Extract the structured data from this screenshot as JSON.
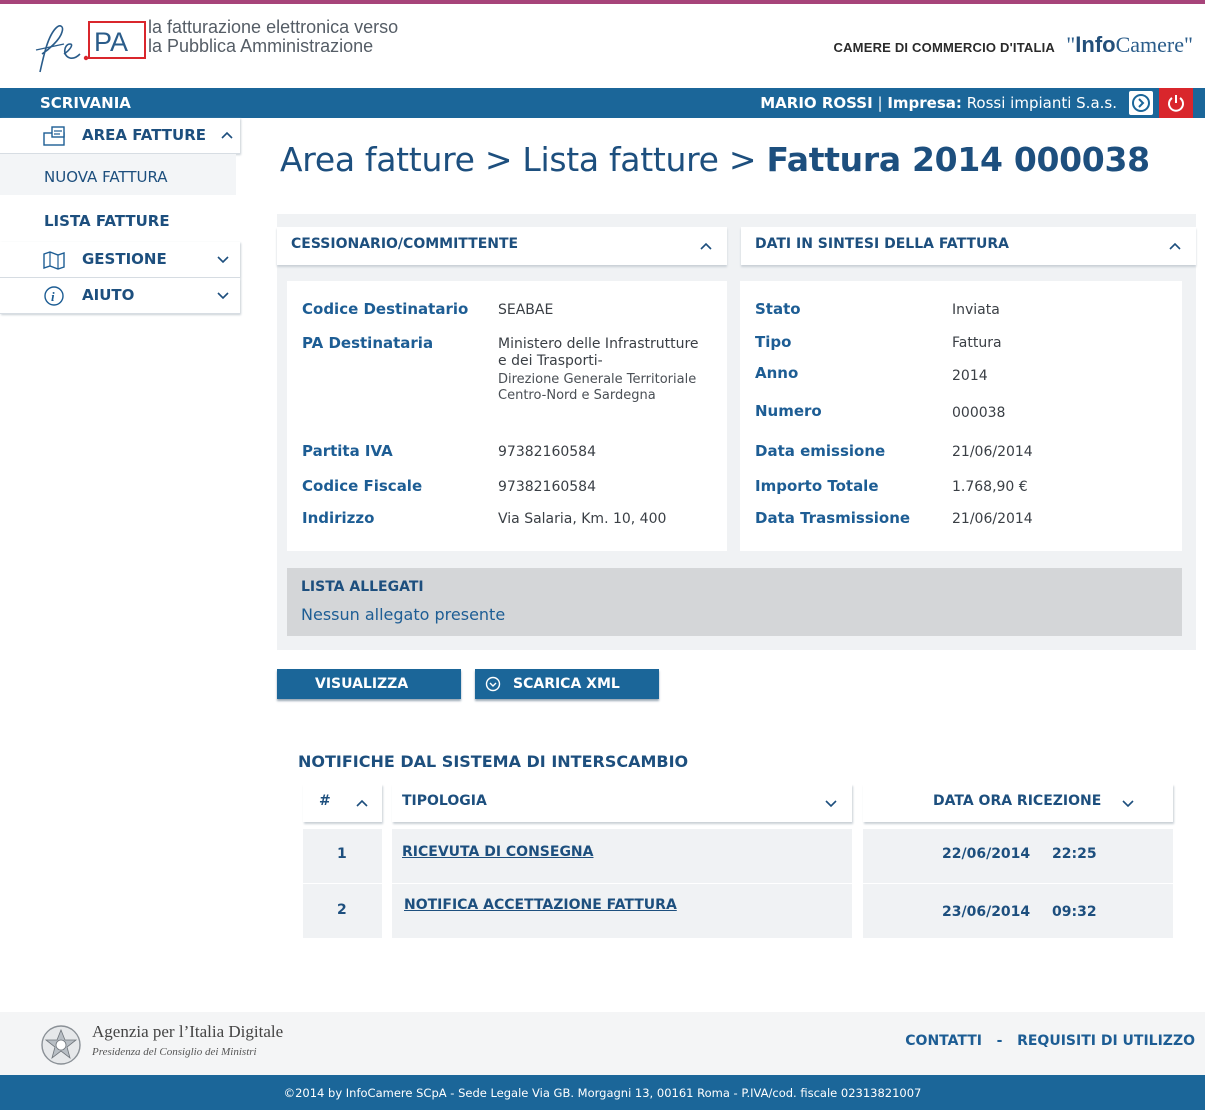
{
  "header": {
    "logo_text": "PA",
    "logo_subtitle_line1": "la fatturazione elettronica verso",
    "logo_subtitle_line2": "la Pubblica Amministrazione",
    "camere_label": "CAMERE DI COMMERCIO D'ITALIA",
    "infocamere_bold": "Info",
    "infocamere_rest": "Camere",
    "infocamere_quote_open": "\"",
    "infocamere_quote_close": "\""
  },
  "topbar": {
    "scrivania": "SCRIVANIA",
    "user_name": "MARIO ROSSI",
    "separator": "|",
    "impresa_label": "Impresa:",
    "impresa_value": "Rossi impianti S.a.s."
  },
  "sidebar": {
    "area_fatture": "AREA FATTURE",
    "nuova_fattura": "NUOVA FATTURA",
    "lista_fatture": "LISTA FATTURE",
    "gestione": "GESTIONE",
    "aiuto": "AIUTO"
  },
  "breadcrumb": {
    "part1": "Area fatture",
    "sep": ">",
    "part2": "Lista fatture",
    "current": "Fattura 2014 000038"
  },
  "cessionario": {
    "title": "CESSIONARIO/COMMITTENTE",
    "codice_destinatario_label": "Codice Destinatario",
    "codice_destinatario_value": "SEABAE",
    "pa_destinataria_label": "PA Destinataria",
    "pa_line1": "Ministero delle Infrastrutture",
    "pa_line2": "e dei Trasporti-",
    "pa_line3": "Direzione Generale Territoriale",
    "pa_line4": "Centro-Nord e Sardegna",
    "partita_iva_label": "Partita IVA",
    "partita_iva_value": "97382160584",
    "codice_fiscale_label": "Codice Fiscale",
    "codice_fiscale_value": "97382160584",
    "indirizzo_label": "Indirizzo",
    "indirizzo_value": "Via Salaria, Km. 10, 400"
  },
  "sintesi": {
    "title": "DATI IN SINTESI DELLA FATTURA",
    "stato_label": "Stato",
    "stato_value": "Inviata",
    "tipo_label": "Tipo",
    "tipo_value": "Fattura",
    "anno_label": "Anno",
    "anno_value": "2014",
    "numero_label": "Numero",
    "numero_value": "000038",
    "data_emissione_label": "Data emissione",
    "data_emissione_value": "21/06/2014",
    "importo_label": "Importo Totale",
    "importo_value": "1.768,90 €",
    "data_trasmissione_label": "Data Trasmissione",
    "data_trasmissione_value": "21/06/2014"
  },
  "allegati": {
    "title": "LISTA ALLEGATI",
    "empty": "Nessun allegato presente"
  },
  "actions": {
    "visualizza": "VISUALIZZA",
    "scarica_xml": "SCARICA XML"
  },
  "notifiche": {
    "title": "NOTIFICHE DAL SISTEMA DI INTERSCAMBIO",
    "col_num": "#",
    "col_tipologia": "TIPOLOGIA",
    "col_data": "DATA ORA RICEZIONE",
    "rows": [
      {
        "num": "1",
        "tipologia": "RICEVUTA DI CONSEGNA",
        "data": "22/06/2014",
        "ora": "22:25"
      },
      {
        "num": "2",
        "tipologia": "NOTIFICA ACCETTAZIONE  FATTURA",
        "data": "23/06/2014",
        "ora": "09:32"
      }
    ]
  },
  "footer": {
    "agid_title": "Agenzia per l’Italia Digitale",
    "agid_subtitle": "Presidenza del Consiglio dei Ministri",
    "contatti": "CONTATTI",
    "dash": "-",
    "requisiti": "REQUISITI DI UTILIZZO",
    "copyright": "©2014 by InfoCamere SCpA  -  Sede Legale Via GB. Morgagni 13, 00161 Roma  -  P.IVA/cod. fiscale 02313821007"
  },
  "colors": {
    "brand_blue": "#1b6699",
    "text_blue": "#1d4f7e",
    "accent_red": "#d9262c",
    "top_accent": "#a7447a"
  },
  "icons": {
    "logo": "fe-pa-logo-icon",
    "next": "arrow-right-circle-icon",
    "power": "power-icon",
    "area_fatture": "invoice-folder-icon",
    "gestione": "map-icon",
    "aiuto": "info-icon",
    "chevron_up": "chevron-up-icon",
    "chevron_down": "chevron-down-icon",
    "download": "download-circle-icon",
    "emblem": "italian-emblem-icon"
  }
}
